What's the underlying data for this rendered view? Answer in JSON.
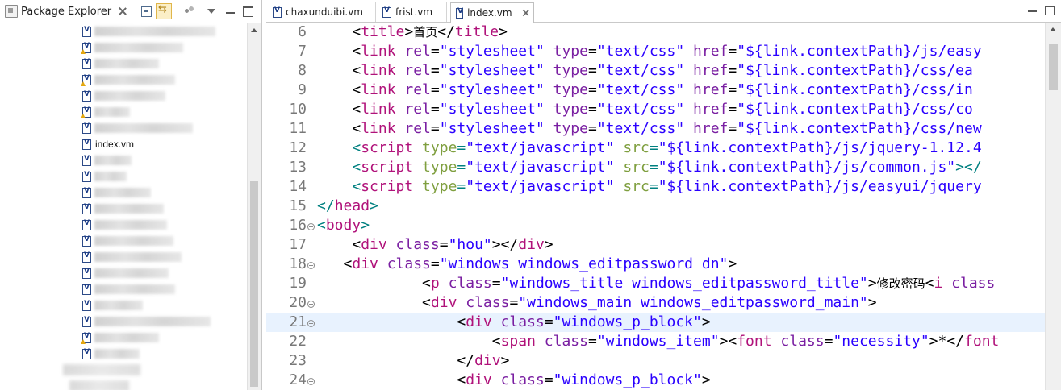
{
  "package_explorer": {
    "title": "Package Explorer",
    "highlighted_file": "index.vm"
  },
  "editor": {
    "tabs": [
      {
        "label": "chaxunduibi.vm",
        "active": false
      },
      {
        "label": "frist.vm",
        "active": false
      },
      {
        "label": "index.vm",
        "active": true
      }
    ],
    "lines": [
      {
        "n": "6",
        "fold": false,
        "hl": false
      },
      {
        "n": "7",
        "fold": false,
        "hl": false
      },
      {
        "n": "8",
        "fold": false,
        "hl": false
      },
      {
        "n": "9",
        "fold": false,
        "hl": false
      },
      {
        "n": "10",
        "fold": false,
        "hl": false
      },
      {
        "n": "11",
        "fold": false,
        "hl": false
      },
      {
        "n": "12",
        "fold": false,
        "hl": false
      },
      {
        "n": "13",
        "fold": false,
        "hl": false
      },
      {
        "n": "14",
        "fold": false,
        "hl": false
      },
      {
        "n": "15",
        "fold": false,
        "hl": false
      },
      {
        "n": "16",
        "fold": true,
        "hl": false
      },
      {
        "n": "17",
        "fold": false,
        "hl": false
      },
      {
        "n": "18",
        "fold": true,
        "hl": false
      },
      {
        "n": "19",
        "fold": false,
        "hl": false
      },
      {
        "n": "20",
        "fold": true,
        "hl": false
      },
      {
        "n": "21",
        "fold": true,
        "hl": true
      },
      {
        "n": "22",
        "fold": false,
        "hl": false
      },
      {
        "n": "23",
        "fold": false,
        "hl": false
      },
      {
        "n": "24",
        "fold": true,
        "hl": false
      }
    ],
    "code": [
      [
        [
          "",
          "    <"
        ],
        [
          "tg",
          "title"
        ],
        [
          "",
          ">"
        ],
        [
          "cn",
          "首页"
        ],
        [
          "",
          "</"
        ],
        [
          "tg",
          "title"
        ],
        [
          "",
          ">"
        ]
      ],
      [
        [
          "",
          "    <"
        ],
        [
          "tg",
          "link"
        ],
        [
          "at",
          " rel"
        ],
        [
          "",
          "="
        ],
        [
          "st",
          "\"stylesheet\""
        ],
        [
          "at",
          " type"
        ],
        [
          "",
          "="
        ],
        [
          "st",
          "\"text/css\""
        ],
        [
          "at",
          " href"
        ],
        [
          "",
          "="
        ],
        [
          "st",
          "\"${link.contextPath}/js/easy"
        ]
      ],
      [
        [
          "",
          "    <"
        ],
        [
          "tg",
          "link"
        ],
        [
          "at",
          " rel"
        ],
        [
          "",
          "="
        ],
        [
          "st",
          "\"stylesheet\""
        ],
        [
          "at",
          " type"
        ],
        [
          "",
          "="
        ],
        [
          "st",
          "\"text/css\""
        ],
        [
          "at",
          " href"
        ],
        [
          "",
          "="
        ],
        [
          "st",
          "\"${link.contextPath}/css/ea"
        ]
      ],
      [
        [
          "",
          "    <"
        ],
        [
          "tg",
          "link"
        ],
        [
          "at",
          " rel"
        ],
        [
          "",
          "="
        ],
        [
          "st",
          "\"stylesheet\""
        ],
        [
          "at",
          " type"
        ],
        [
          "",
          "="
        ],
        [
          "st",
          "\"text/css\""
        ],
        [
          "at",
          " href"
        ],
        [
          "",
          "="
        ],
        [
          "st",
          "\"${link.contextPath}/css/in"
        ]
      ],
      [
        [
          "",
          "    <"
        ],
        [
          "tg",
          "link"
        ],
        [
          "at",
          " rel"
        ],
        [
          "",
          "="
        ],
        [
          "st",
          "\"stylesheet\""
        ],
        [
          "at",
          " type"
        ],
        [
          "",
          "="
        ],
        [
          "st",
          "\"text/css\""
        ],
        [
          "at",
          " href"
        ],
        [
          "",
          "="
        ],
        [
          "st",
          "\"${link.contextPath}/css/co"
        ]
      ],
      [
        [
          "",
          "    <"
        ],
        [
          "tg",
          "link"
        ],
        [
          "at",
          " rel"
        ],
        [
          "",
          "="
        ],
        [
          "st",
          "\"stylesheet\""
        ],
        [
          "at",
          " type"
        ],
        [
          "",
          "="
        ],
        [
          "st",
          "\"text/css\""
        ],
        [
          "at",
          " href"
        ],
        [
          "",
          "="
        ],
        [
          "st",
          "\"${link.contextPath}/css/new"
        ]
      ],
      [
        [
          "tgp",
          "    <"
        ],
        [
          "tg",
          "script"
        ],
        [
          "sat",
          " type"
        ],
        [
          "tgp",
          "="
        ],
        [
          "st",
          "\"text/javascript\""
        ],
        [
          "sat",
          " src"
        ],
        [
          "tgp",
          "="
        ],
        [
          "st",
          "\"${link.contextPath}/js/jquery-1.12.4"
        ]
      ],
      [
        [
          "tgp",
          "    <"
        ],
        [
          "tg",
          "script"
        ],
        [
          "sat",
          " type"
        ],
        [
          "tgp",
          "="
        ],
        [
          "st",
          "\"text/javascript\""
        ],
        [
          "sat",
          " src"
        ],
        [
          "tgp",
          "="
        ],
        [
          "st",
          "\"${link.contextPath}/js/common.js\""
        ],
        [
          "tgp",
          "></"
        ]
      ],
      [
        [
          "tgp",
          "    <"
        ],
        [
          "tg",
          "script"
        ],
        [
          "sat",
          " type"
        ],
        [
          "tgp",
          "="
        ],
        [
          "st",
          "\"text/javascript\""
        ],
        [
          "sat",
          " src"
        ],
        [
          "tgp",
          "="
        ],
        [
          "st",
          "\"${link.contextPath}/js/easyui/jquery"
        ]
      ],
      [
        [
          "tgp",
          "</"
        ],
        [
          "tg",
          "head"
        ],
        [
          "tgp",
          ">"
        ]
      ],
      [
        [
          "tgp",
          "<"
        ],
        [
          "tg",
          "body"
        ],
        [
          "tgp",
          ">"
        ]
      ],
      [
        [
          "",
          "    <"
        ],
        [
          "tg",
          "div"
        ],
        [
          "at",
          " class"
        ],
        [
          "",
          "="
        ],
        [
          "st",
          "\"hou\""
        ],
        [
          "",
          "></"
        ],
        [
          "tg",
          "div"
        ],
        [
          "",
          ">"
        ]
      ],
      [
        [
          "",
          "   <"
        ],
        [
          "tg",
          "div"
        ],
        [
          "at",
          " class"
        ],
        [
          "",
          "="
        ],
        [
          "st",
          "\"windows windows_editpassword dn\""
        ],
        [
          "",
          ">"
        ]
      ],
      [
        [
          "",
          "            <"
        ],
        [
          "tg",
          "p"
        ],
        [
          "at",
          " class"
        ],
        [
          "",
          "="
        ],
        [
          "st",
          "\"windows_title windows_editpassword_title\""
        ],
        [
          "",
          ">"
        ],
        [
          "cn",
          "修改密码"
        ],
        [
          "",
          "<"
        ],
        [
          "tg",
          "i"
        ],
        [
          "at",
          " class"
        ]
      ],
      [
        [
          "",
          "            <"
        ],
        [
          "tg",
          "div"
        ],
        [
          "at",
          " class"
        ],
        [
          "",
          "="
        ],
        [
          "st",
          "\"windows_main windows_editpassword_main\""
        ],
        [
          "",
          ">"
        ]
      ],
      [
        [
          "",
          "                <"
        ],
        [
          "tg",
          "div"
        ],
        [
          "at",
          " class"
        ],
        [
          "",
          "="
        ],
        [
          "st",
          "\"windows_p_block\""
        ],
        [
          "",
          ">"
        ]
      ],
      [
        [
          "",
          "                    <"
        ],
        [
          "tg",
          "span"
        ],
        [
          "at",
          " class"
        ],
        [
          "",
          "="
        ],
        [
          "st",
          "\"windows_item\""
        ],
        [
          "",
          "><"
        ],
        [
          "tg",
          "font"
        ],
        [
          "at",
          " class"
        ],
        [
          "",
          "="
        ],
        [
          "st",
          "\"necessity\""
        ],
        [
          "",
          ">*</"
        ],
        [
          "tg",
          "font"
        ]
      ],
      [
        [
          "",
          "                </"
        ],
        [
          "tg",
          "div"
        ],
        [
          "",
          ">"
        ]
      ],
      [
        [
          "",
          "                <"
        ],
        [
          "tg",
          "div"
        ],
        [
          "at",
          " class"
        ],
        [
          "",
          "="
        ],
        [
          "st",
          "\"windows_p_block\""
        ],
        [
          "",
          ">"
        ]
      ]
    ]
  }
}
